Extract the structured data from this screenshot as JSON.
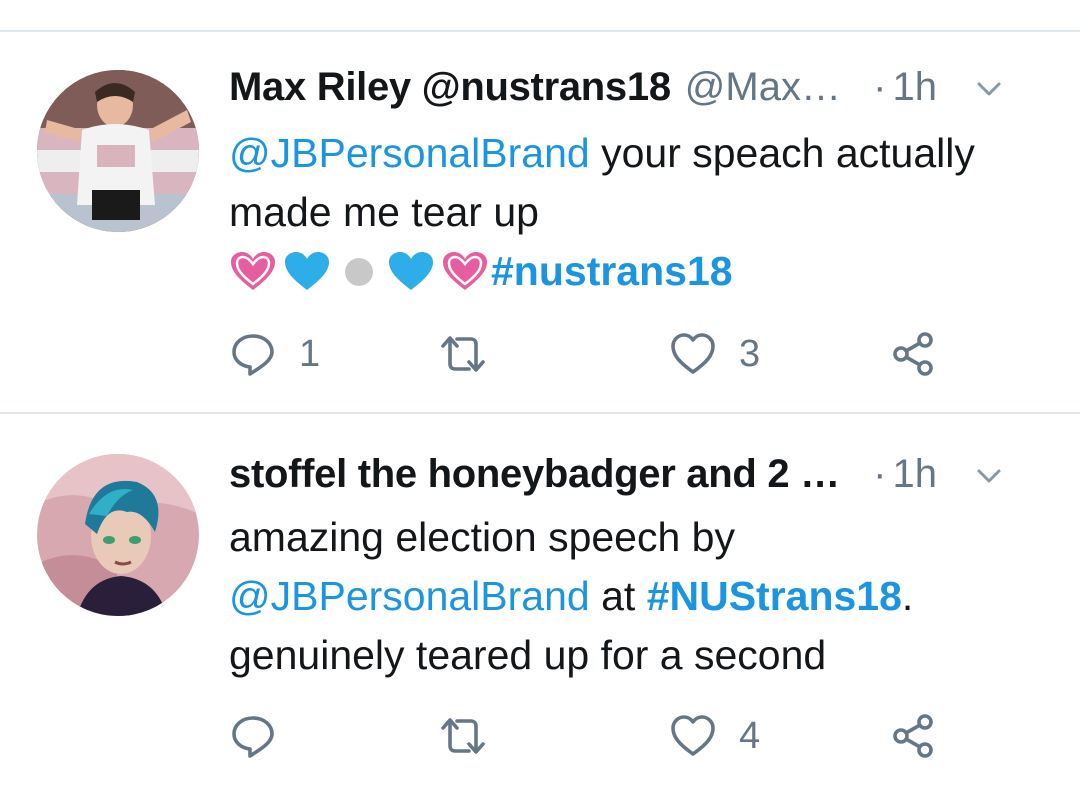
{
  "tweets": [
    {
      "name": "Max Riley @nustrans18",
      "handle": "@Max…",
      "time": "1h",
      "text_link": "@JBPersonalBrand",
      "text_line1": " your speach actually",
      "text_line2": "made me tear up",
      "hashtag": "#nustrans18",
      "reply_count": "1",
      "retweet_count": "",
      "like_count": "3"
    },
    {
      "name": "stoffel the honeybadger and 2 …",
      "time": "1h",
      "text_line1": "amazing election speech by",
      "text_link": "@JBPersonalBrand",
      "text_mid": " at ",
      "hashtag": "#NUStrans18",
      "text_end": ".",
      "text_line3": "genuinely teared up for a second",
      "reply_count": "",
      "retweet_count": "",
      "like_count": "4"
    }
  ],
  "colors": {
    "link": "#1b95e0",
    "secondary_text": "#657786",
    "divider": "#e1e8ed",
    "emoji_pink": "#e75ea0",
    "emoji_blue": "#2eaee8",
    "emoji_white": "#c8c8c8"
  },
  "icons": [
    "chevron-down-icon",
    "reply-icon",
    "retweet-icon",
    "like-icon",
    "share-icon",
    "pink-heart-emoji",
    "blue-heart-emoji",
    "white-circle-emoji"
  ]
}
